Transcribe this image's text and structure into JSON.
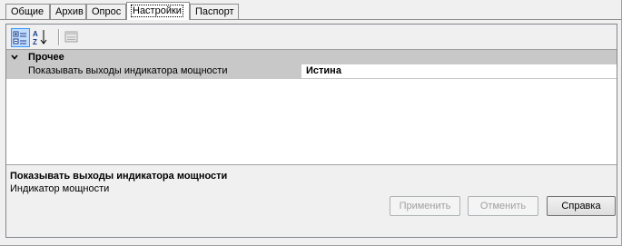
{
  "tabs": [
    {
      "label": "Общие"
    },
    {
      "label": "Архив"
    },
    {
      "label": "Опрос"
    },
    {
      "label": "Настройки",
      "active": true
    },
    {
      "label": "Паспорт"
    }
  ],
  "toolbar": {
    "categorized_icon": "categorized-view-icon",
    "alphabetical_icon": "sort-alphabetical-icon",
    "property_pages_icon": "property-pages-icon"
  },
  "grid": {
    "category": "Прочее",
    "property": {
      "name": "Показывать выходы индикатора мощности",
      "value": "Истина"
    }
  },
  "description": {
    "title": "Показывать выходы индикатора мощности",
    "text": "Индикатор мощности"
  },
  "buttons": {
    "apply": "Применить",
    "cancel": "Отменить",
    "help": "Справка"
  },
  "colors": {
    "category_bg": "#c8c8c8",
    "accent": "#3399ff"
  }
}
